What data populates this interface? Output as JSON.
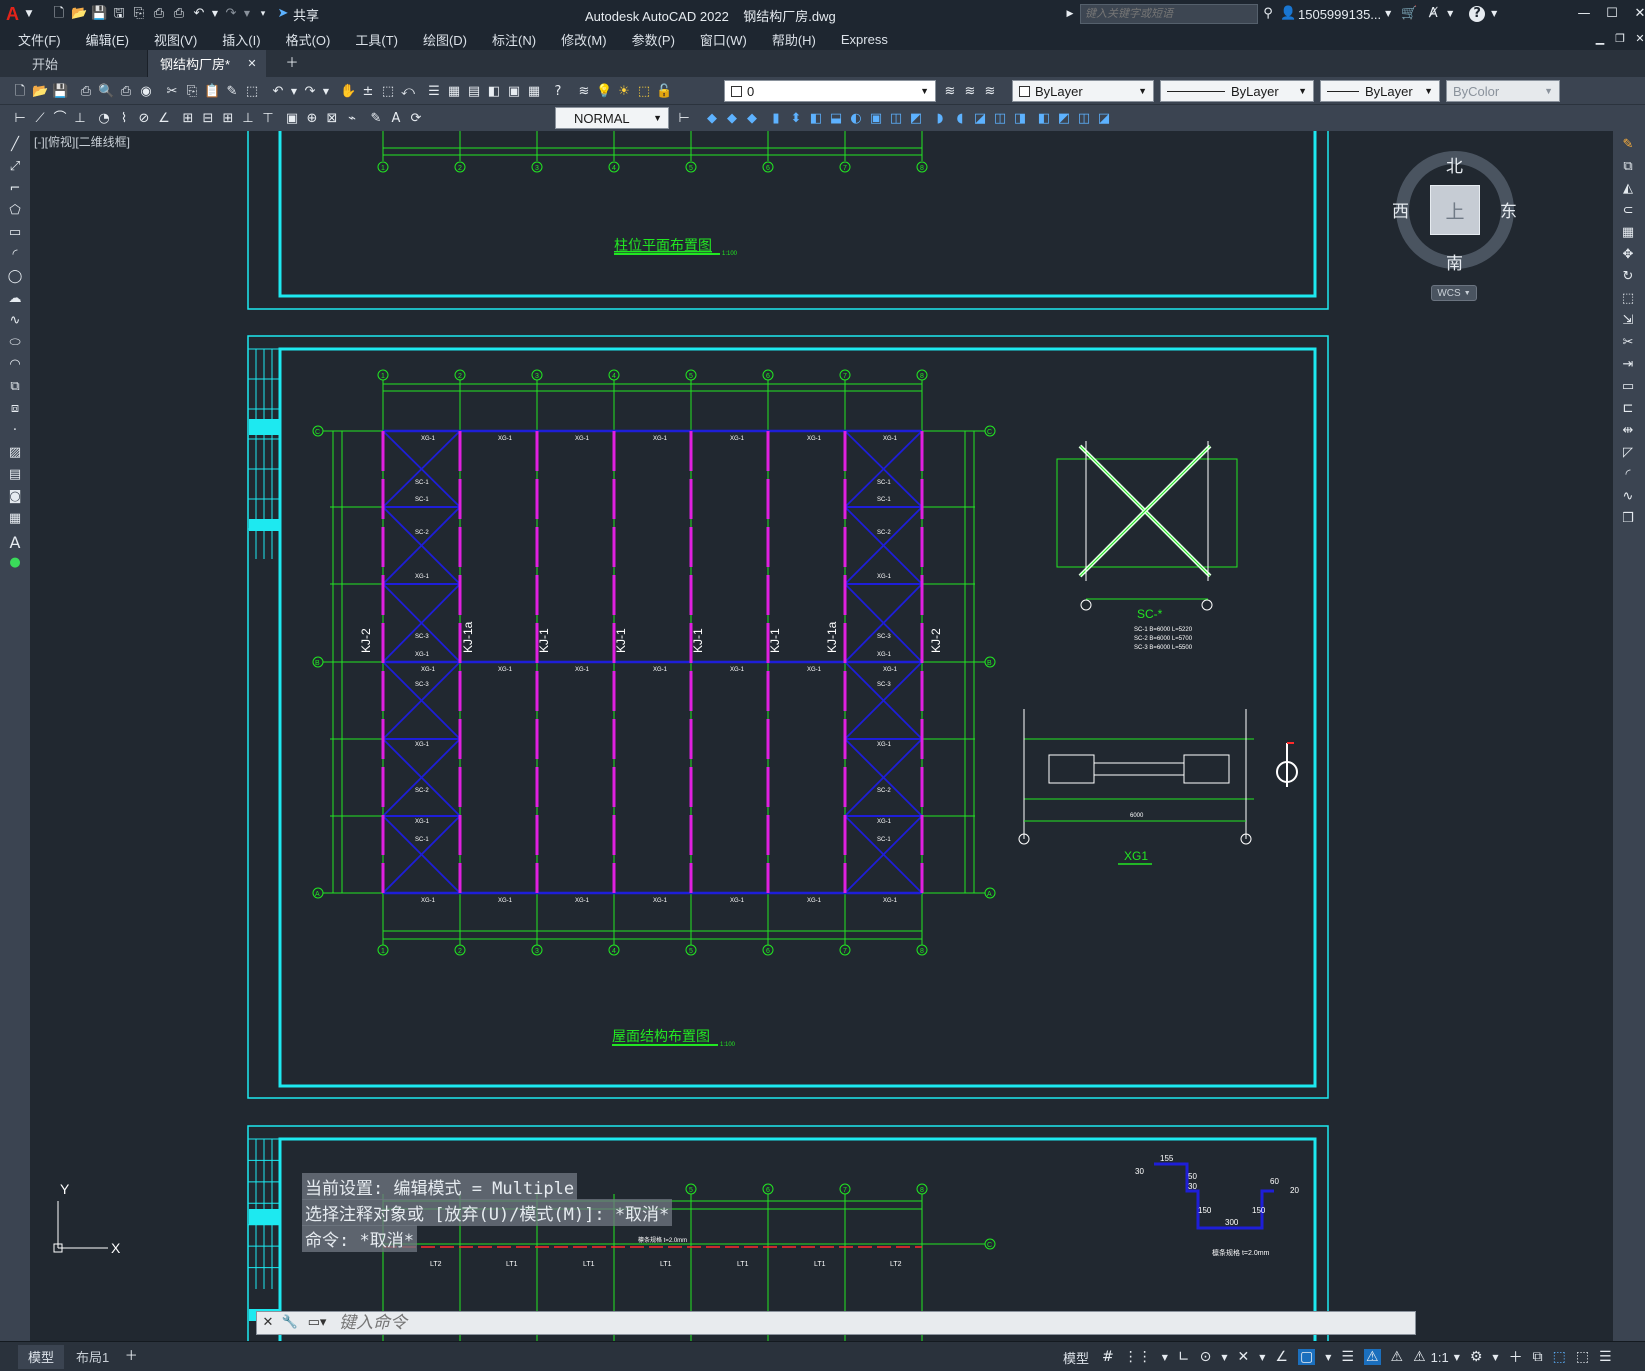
{
  "window": {
    "title": "Autodesk AutoCAD 2022    钢结构厂房.dwg",
    "share_label": "共享",
    "search_placeholder": "键入关键字或短语",
    "user": "1505999135...",
    "app_letter": "A"
  },
  "menu": [
    "文件(F)",
    "编辑(E)",
    "视图(V)",
    "插入(I)",
    "格式(O)",
    "工具(T)",
    "绘图(D)",
    "标注(N)",
    "修改(M)",
    "参数(P)",
    "窗口(W)",
    "帮助(H)",
    "Express"
  ],
  "tabs": [
    {
      "label": "开始",
      "active": false
    },
    {
      "label": "钢结构厂房*",
      "active": true
    }
  ],
  "toolbar": {
    "layer_value": "0",
    "color_value": "ByLayer",
    "linetype_value": "ByLayer",
    "lineweight_value": "ByLayer",
    "plotstyle_value": "ByColor",
    "textstyle_value": "NORMAL"
  },
  "viewport": {
    "label": "[-][俯视][二维线框]"
  },
  "viewcube": {
    "north": "北",
    "south": "南",
    "east": "东",
    "west": "西",
    "face": "上",
    "wcs": "WCS"
  },
  "drawing": {
    "title_top": "柱位平面布置图",
    "title_top_scale": "1:100",
    "title_main": "屋面结构布置图",
    "title_main_scale": "1:100",
    "grid_numbers": [
      "1",
      "2",
      "3",
      "4",
      "5",
      "6",
      "7",
      "8"
    ],
    "grid_letters": [
      "C",
      "B",
      "A"
    ],
    "frame_labels": [
      "KJ-2",
      "KJ-1a",
      "KJ-1",
      "KJ-1",
      "KJ-1",
      "KJ-1",
      "KJ-1a",
      "KJ-2"
    ],
    "purlin_label": "XG-1",
    "left_bay_labels": [
      "SC-1",
      "SC-1",
      "SC-2",
      "XG-1",
      "SC-3",
      "XG-1",
      "SC-3",
      "XG-1",
      "SC-2",
      "XG-1",
      "SC-1"
    ],
    "brace_title": "SC-*",
    "brace_specs": [
      "SC-1  B=6000  L=5220",
      "SC-2  B=6000  L=5700",
      "SC-3  B=6000  L=5500"
    ],
    "xg_title": "XG1",
    "xg_dim": "6000",
    "section_dims": [
      "155",
      "30",
      "50",
      "30",
      "150",
      "300",
      "150",
      "60",
      "20"
    ],
    "section_note": "檩条规格  t=2.0mm",
    "bottom_labels": [
      "LT2",
      "LT1",
      "LT1",
      "LT1",
      "LT1",
      "LT1",
      "LT2"
    ],
    "bottom_note": "檩条规格  t=2.0mm"
  },
  "command": {
    "history": [
      "当前设置: 编辑模式 = Multiple",
      "选择注释对象或 [放弃(U)/模式(M)]: *取消*",
      "命令: *取消*"
    ],
    "placeholder": "键入命令"
  },
  "status": {
    "layout_tabs": [
      "模型",
      "布局1"
    ],
    "model_label": "模型",
    "scale": "1:1"
  },
  "colors": {
    "cyan": "#1de9f0",
    "green": "#22e622",
    "blue": "#1e1ed8",
    "magenta": "#e020e0",
    "red": "#ff2a2a",
    "white": "#ffffff",
    "background": "#212830"
  }
}
